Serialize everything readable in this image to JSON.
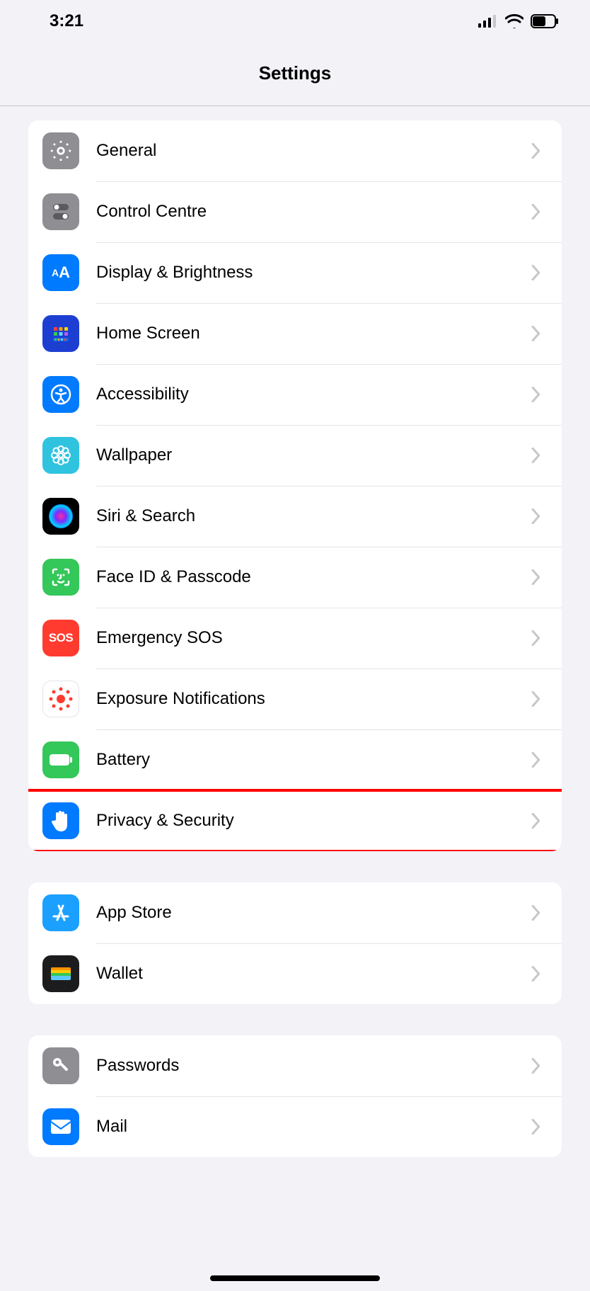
{
  "status": {
    "time": "3:21"
  },
  "title": "Settings",
  "groups": [
    {
      "items": [
        {
          "key": "general",
          "label": "General"
        },
        {
          "key": "controlcentre",
          "label": "Control Centre"
        },
        {
          "key": "display",
          "label": "Display & Brightness"
        },
        {
          "key": "homescreen",
          "label": "Home Screen"
        },
        {
          "key": "accessibility",
          "label": "Accessibility"
        },
        {
          "key": "wallpaper",
          "label": "Wallpaper"
        },
        {
          "key": "siri",
          "label": "Siri & Search"
        },
        {
          "key": "faceid",
          "label": "Face ID & Passcode"
        },
        {
          "key": "sos",
          "label": "Emergency SOS"
        },
        {
          "key": "exposure",
          "label": "Exposure Notifications"
        },
        {
          "key": "battery",
          "label": "Battery"
        },
        {
          "key": "privacy",
          "label": "Privacy & Security"
        }
      ]
    },
    {
      "items": [
        {
          "key": "appstore",
          "label": "App Store"
        },
        {
          "key": "wallet",
          "label": "Wallet"
        }
      ]
    },
    {
      "items": [
        {
          "key": "passwords",
          "label": "Passwords"
        },
        {
          "key": "mail",
          "label": "Mail"
        }
      ]
    }
  ]
}
